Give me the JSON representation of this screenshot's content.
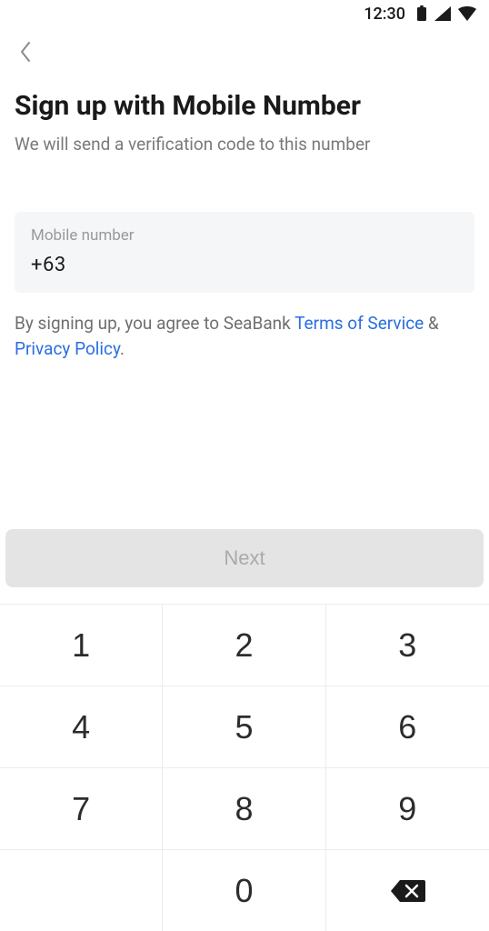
{
  "status": {
    "time": "12:30"
  },
  "header": {
    "title": "Sign up with Mobile Number",
    "subtitle": "We will send a verification code to this number"
  },
  "input": {
    "label": "Mobile number",
    "value": "+63"
  },
  "agreement": {
    "prefix": "By signing up, you agree to SeaBank ",
    "tos": "Terms of Service",
    "middle": " & ",
    "privacy": "Privacy Policy",
    "suffix": "."
  },
  "actions": {
    "next": "Next"
  },
  "keypad": {
    "k1": "1",
    "k2": "2",
    "k3": "3",
    "k4": "4",
    "k5": "5",
    "k6": "6",
    "k7": "7",
    "k8": "8",
    "k9": "9",
    "k0": "0"
  }
}
